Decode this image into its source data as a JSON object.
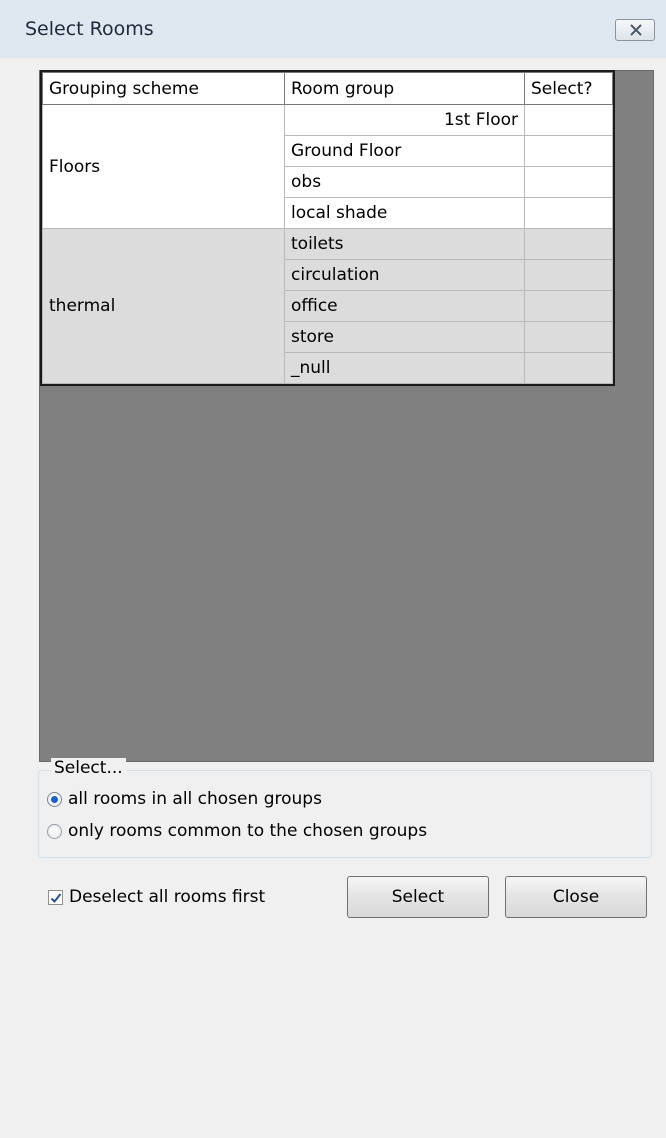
{
  "window": {
    "title": "Select Rooms",
    "close_icon": "close-icon"
  },
  "table": {
    "headers": [
      "Grouping scheme",
      "Room group",
      "Select?"
    ],
    "groups": [
      {
        "scheme": "Floors",
        "rooms": [
          "1st Floor",
          "Ground Floor",
          "obs",
          "local shade"
        ]
      },
      {
        "scheme": "thermal",
        "rooms": [
          "toilets",
          "circulation",
          "office",
          "store",
          "_null"
        ]
      }
    ]
  },
  "select_group": {
    "legend": "Select...",
    "options": [
      {
        "label": "all rooms in all chosen groups",
        "selected": true
      },
      {
        "label": "only rooms common to the chosen groups",
        "selected": false
      }
    ]
  },
  "deselect": {
    "label": "Deselect all rooms first",
    "checked": true
  },
  "buttons": {
    "select": "Select",
    "close": "Close"
  }
}
